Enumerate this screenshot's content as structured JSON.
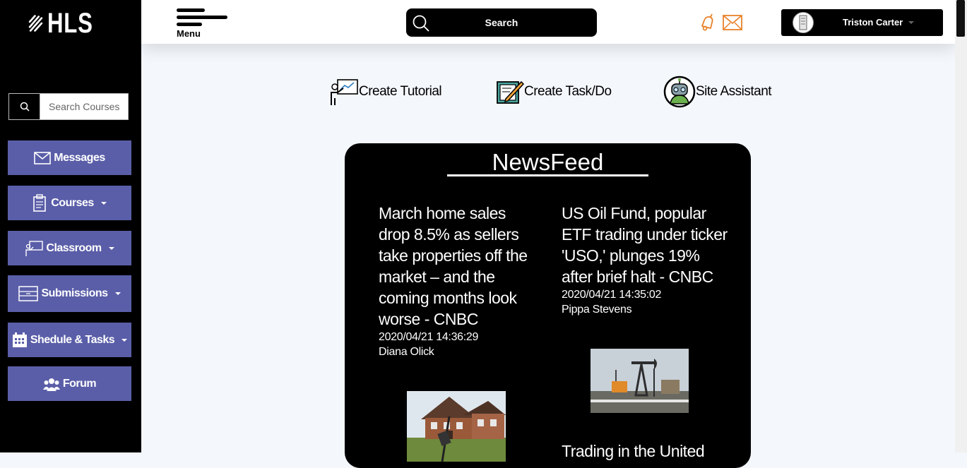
{
  "sidebar": {
    "logo_text": "HLS",
    "search_placeholder": "Search Courses",
    "items": [
      {
        "label": "Messages"
      },
      {
        "label": "Courses"
      },
      {
        "label": "Classroom"
      },
      {
        "label": "Submissions"
      },
      {
        "label": "Shedule & Tasks"
      },
      {
        "label": "Forum"
      }
    ]
  },
  "header": {
    "menu_label": "Menu",
    "search_label": "Search",
    "user_name": "Triston Carter"
  },
  "quick_actions": [
    {
      "label": "Create Tutorial"
    },
    {
      "label": "Create Task/Do"
    },
    {
      "label": "Site Assistant"
    }
  ],
  "newsfeed": {
    "title": "NewsFeed",
    "articles": [
      {
        "headline": "March home sales drop 8.5% as sellers take properties off the market – and the coming months look worse - CNBC",
        "timestamp": "2020/04/21 14:36:29",
        "author": "Diana Olick"
      },
      {
        "headline": "US Oil Fund, popular ETF trading under ticker 'USO,' plunges 19% after brief halt - CNBC",
        "timestamp": "2020/04/21 14:35:02",
        "author": "Pippa Stevens"
      },
      {
        "headline": "Trading in the United"
      }
    ]
  },
  "colors": {
    "sidebar_bg": "#000000",
    "nav_button": "#5a5ea8",
    "accent_orange": "#e8822a",
    "page_bg": "#f4f7fb"
  }
}
